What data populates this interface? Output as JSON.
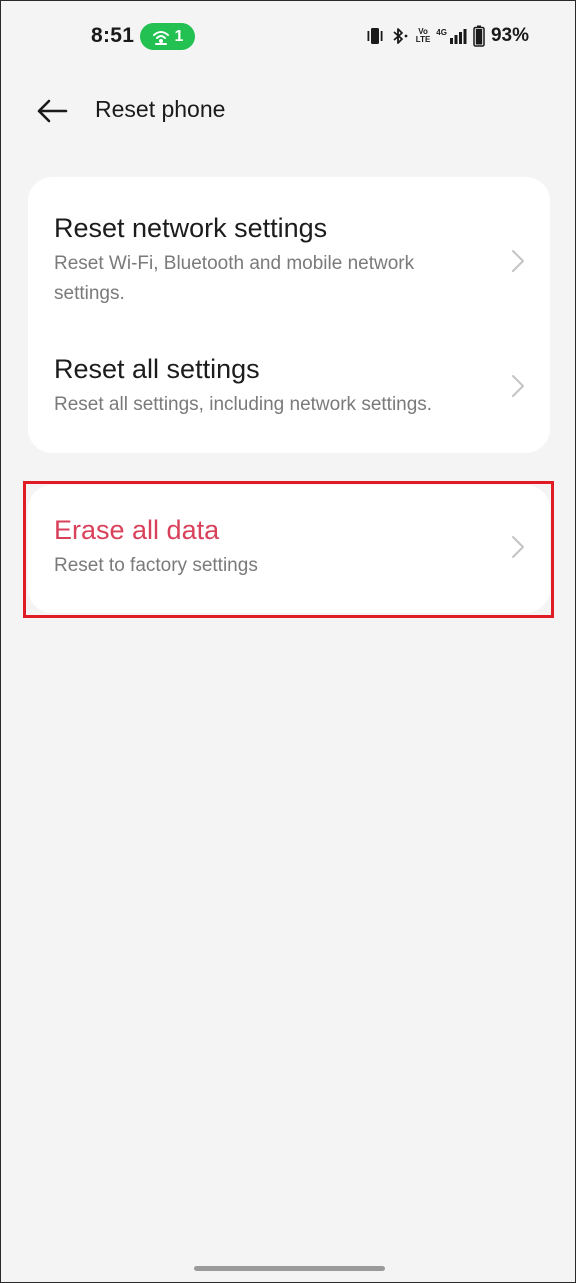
{
  "status_bar": {
    "time": "8:51",
    "hotspot_count": "1",
    "hotspot_color": "#23c152",
    "icons": [
      "vibrate-icon",
      "bluetooth-icon",
      "volte-icon",
      "signal-icon",
      "battery-icon"
    ],
    "volte_top": "Vo",
    "volte_bottom": "LTE",
    "network_type": "4G",
    "battery_percent": "93%"
  },
  "header": {
    "title": "Reset phone",
    "back_icon": "arrow-left-icon"
  },
  "options": [
    {
      "title": "Reset network settings",
      "subtitle": "Reset Wi-Fi, Bluetooth and mobile network settings."
    },
    {
      "title": "Reset all settings",
      "subtitle": "Reset all settings, including network settings."
    },
    {
      "title": "Erase all data",
      "subtitle": "Reset to factory settings",
      "title_color": "#d9415b"
    }
  ],
  "colors": {
    "background": "#f4f4f4",
    "card": "#ffffff",
    "danger": "#d9415b",
    "highlight_border": "#e01b24"
  }
}
